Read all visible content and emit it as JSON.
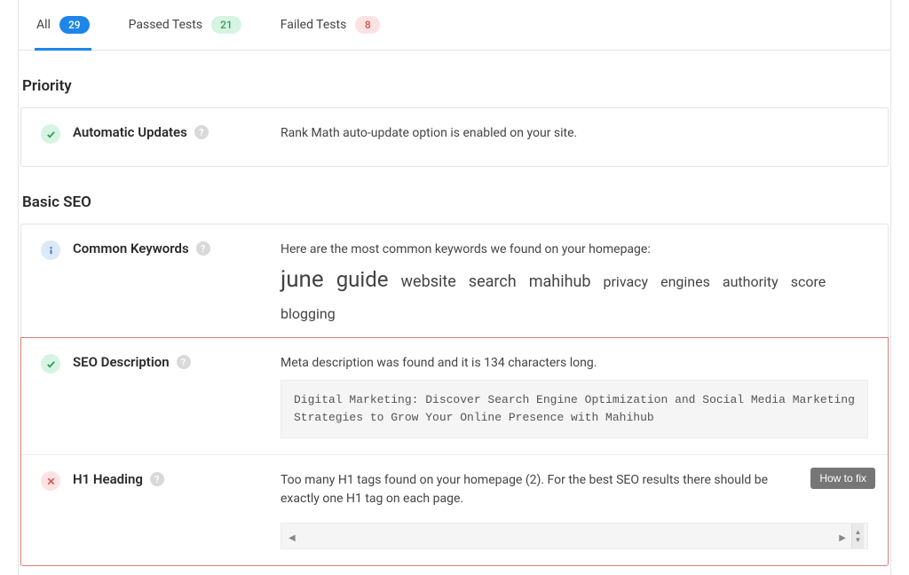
{
  "tabs": [
    {
      "label": "All",
      "count": "29",
      "badge": "blue",
      "active": true
    },
    {
      "label": "Passed Tests",
      "count": "21",
      "badge": "green",
      "active": false
    },
    {
      "label": "Failed Tests",
      "count": "8",
      "badge": "red",
      "active": false
    }
  ],
  "sections": {
    "priority": {
      "heading": "Priority",
      "row": {
        "status": "pass",
        "title": "Automatic Updates",
        "desc": "Rank Math auto-update option is enabled on your site."
      }
    },
    "basic_seo": {
      "heading": "Basic SEO",
      "common_keywords": {
        "status": "info",
        "title": "Common Keywords",
        "desc": "Here are the most common keywords we found on your homepage:",
        "keywords": [
          {
            "text": "june",
            "size": 26
          },
          {
            "text": "guide",
            "size": 24
          },
          {
            "text": "website",
            "size": 18
          },
          {
            "text": "search",
            "size": 18
          },
          {
            "text": "mahihub",
            "size": 18
          },
          {
            "text": "privacy",
            "size": 16
          },
          {
            "text": "engines",
            "size": 16
          },
          {
            "text": "authority",
            "size": 16
          },
          {
            "text": "score",
            "size": 16
          },
          {
            "text": "blogging",
            "size": 16
          }
        ]
      },
      "seo_description": {
        "status": "pass",
        "title": "SEO Description",
        "desc": "Meta description was found and it is 134 characters long.",
        "code": "Digital Marketing: Discover Search Engine Optimization and Social Media Marketing Strategies to Grow Your Online Presence with Mahihub"
      },
      "h1_heading": {
        "status": "fail",
        "title": "H1 Heading",
        "desc": "Too many H1 tags found on your homepage (2). For the best SEO results there should be exactly one H1 tag on each page.",
        "fix_label": "How to fix"
      }
    }
  }
}
